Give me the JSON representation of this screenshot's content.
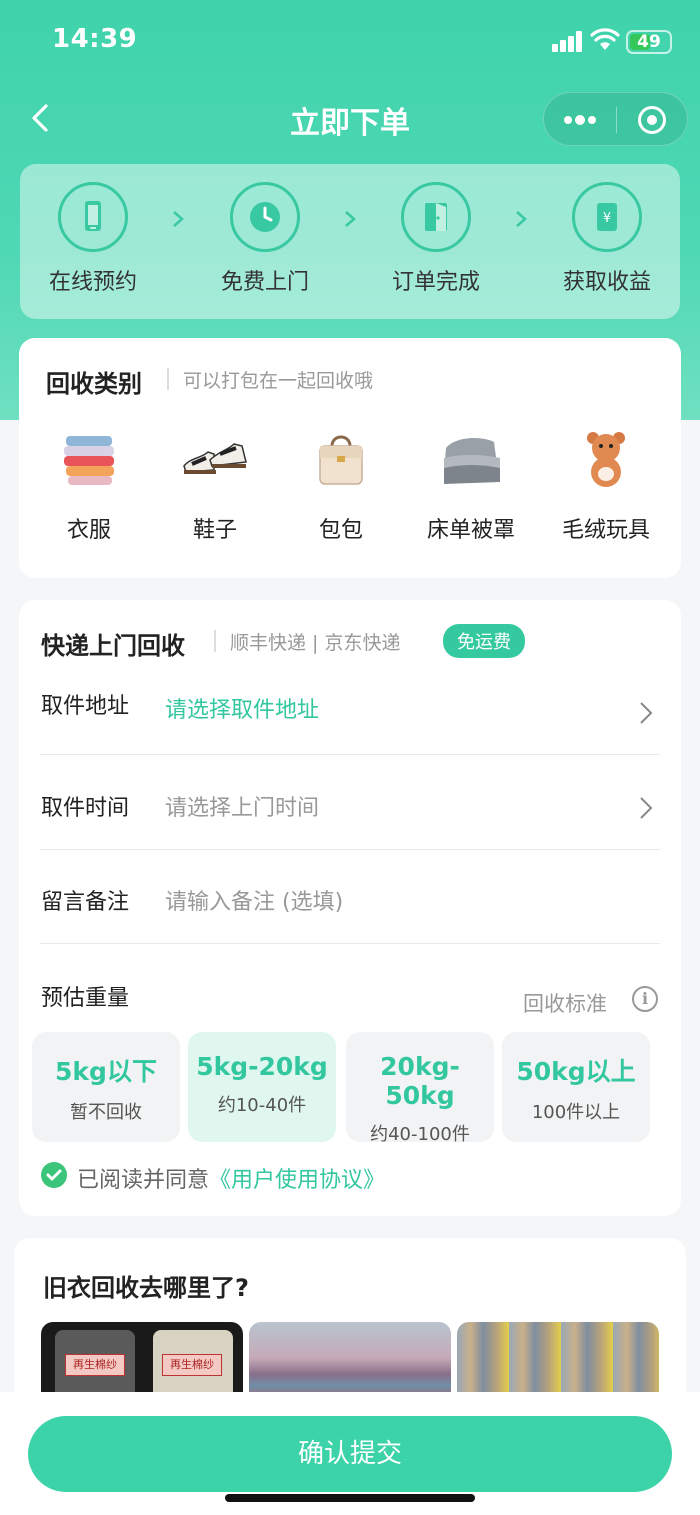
{
  "status_bar": {
    "time": "14:39",
    "battery": "49"
  },
  "nav": {
    "title": "立即下单"
  },
  "steps": [
    {
      "label": "在线预约",
      "icon": "phone-icon"
    },
    {
      "label": "免费上门",
      "icon": "clock-icon"
    },
    {
      "label": "订单完成",
      "icon": "door-icon"
    },
    {
      "label": "获取收益",
      "icon": "money-icon"
    }
  ],
  "category": {
    "title": "回收类别",
    "subtitle": "可以打包在一起回收哦",
    "items": [
      {
        "label": "衣服"
      },
      {
        "label": "鞋子"
      },
      {
        "label": "包包"
      },
      {
        "label": "床单被罩"
      },
      {
        "label": "毛绒玩具"
      }
    ]
  },
  "express": {
    "title": "快递上门回收",
    "carriers": "顺丰快递 | 京东快递",
    "badge": "免运费",
    "address_label": "取件地址",
    "address_value": "请选择取件地址",
    "time_label": "取件时间",
    "time_placeholder": "请选择上门时间",
    "note_label": "留言备注",
    "note_placeholder": "请输入备注 (选填)",
    "weight_label": "预估重量",
    "standard_link": "回收标准",
    "weight_options": [
      {
        "main": "5kg以下",
        "sub": "暂不回收"
      },
      {
        "main": "5kg-20kg",
        "sub": "约10-40件"
      },
      {
        "main": "20kg-50kg",
        "sub": "约40-100件"
      },
      {
        "main": "50kg以上",
        "sub": "100件以上"
      }
    ],
    "agree_prefix": "已阅读并同意",
    "agree_link": "《用户使用协议》"
  },
  "where": {
    "title": "旧衣回收去哪里了?",
    "photo1_tag": "再生棉纱"
  },
  "submit_label": "确认提交",
  "colors": {
    "accent": "#33c7a0",
    "header": "#3fd3ab",
    "button": "#3cd3a9"
  }
}
